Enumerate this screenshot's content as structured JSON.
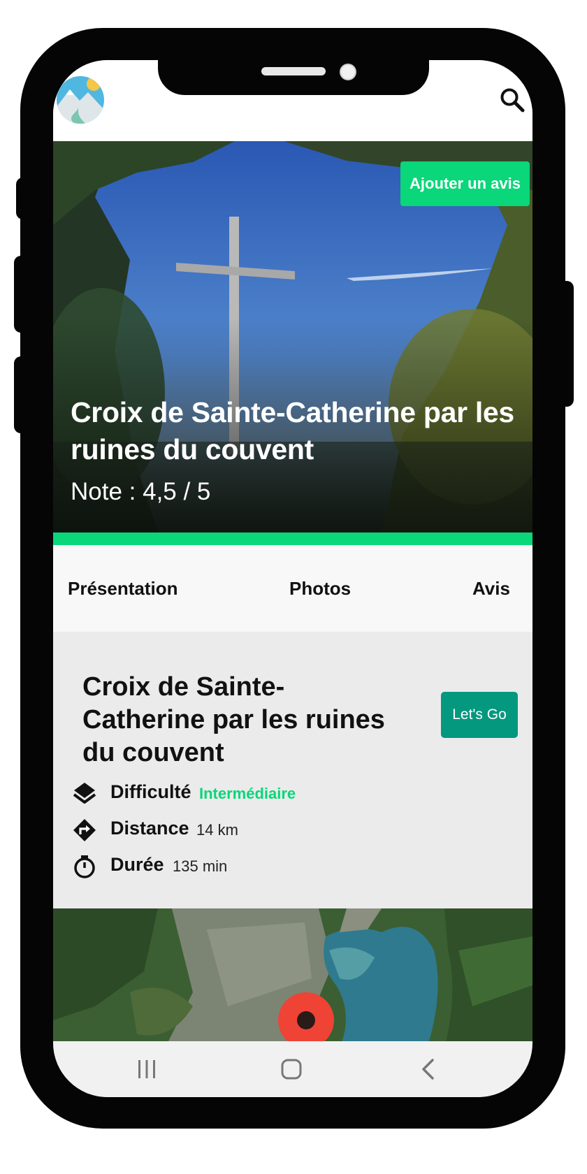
{
  "app": {
    "logo_icon": "mountain-river-logo-icon",
    "search_icon": "search-icon"
  },
  "hero": {
    "add_review_label": "Ajouter un avis",
    "title": "Croix de Sainte-Catherine par les ruines du couvent",
    "rating": "Note : 4,5 / 5"
  },
  "tabs": [
    {
      "label": "Présentation"
    },
    {
      "label": "Photos"
    },
    {
      "label": "Avis"
    }
  ],
  "details": {
    "title": "Croix de Sainte-Catherine par les ruines du couvent",
    "action_label": "Let's Go",
    "stats": [
      {
        "icon": "layers-icon",
        "label": "Difficulté",
        "value": "Intermédiaire",
        "value_color": "#0ad67a"
      },
      {
        "icon": "turn-right-sign-icon",
        "label": "Distance",
        "value": "14 km"
      },
      {
        "icon": "timer-icon",
        "label": "Durée",
        "value": "135 min"
      }
    ]
  },
  "map": {
    "marker_icon": "map-pin-icon"
  },
  "system_nav": {
    "recent_icon": "recent-apps-icon",
    "home_icon": "home-icon",
    "back_icon": "back-icon"
  },
  "colors": {
    "accent": "#0ad67a",
    "cta": "#04987f",
    "frame": "#050505"
  }
}
